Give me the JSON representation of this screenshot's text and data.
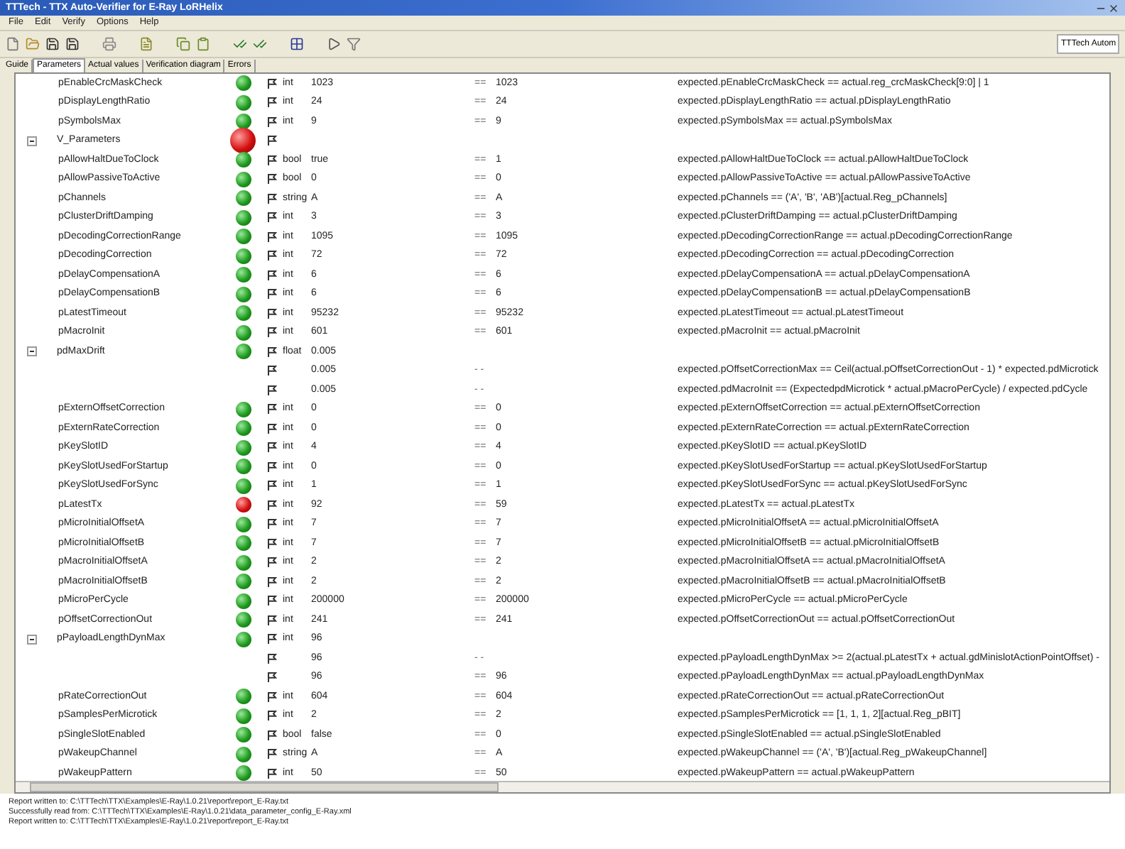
{
  "window": {
    "title": "TTTech - TTX Auto-Verifier for E-Ray LoRHelix"
  },
  "menu": [
    "File",
    "Edit",
    "Verify",
    "Options",
    "Help"
  ],
  "toolbar_combo": {
    "value": "TTTech Autom"
  },
  "tabs": [
    {
      "label": "Guide",
      "selected": false
    },
    {
      "label": "Parameters",
      "selected": true
    },
    {
      "label": "Actual values",
      "selected": false
    },
    {
      "label": "Verification diagram",
      "selected": false
    },
    {
      "label": "Errors",
      "selected": false
    }
  ],
  "rows": [
    {
      "name": "pEnableCrcMaskCheck",
      "passed": true,
      "type": "int",
      "value": "1023",
      "op": "==",
      "actual": "1023",
      "expression": "expected.pEnableCrcMaskCheck == actual.reg_crcMaskCheck[9:0] | 1"
    },
    {
      "name": "pDisplayLengthRatio",
      "passed": true,
      "type": "int",
      "value": "24",
      "op": "==",
      "actual": "24",
      "expression": "expected.pDisplayLengthRatio == actual.pDisplayLengthRatio"
    },
    {
      "name": "pSymbolsMax",
      "passed": true,
      "type": "int",
      "value": "9",
      "op": "==",
      "actual": "9",
      "expression": "expected.pSymbolsMax == actual.pSymbolsMax"
    },
    {
      "name": "V_Parameters",
      "passed": false,
      "expanded": true,
      "children": [
        {
          "name": "pAllowHaltDueToClock",
          "passed": true,
          "type": "bool",
          "value": "true",
          "op": "==",
          "actual": "1",
          "expression": "expected.pAllowHaltDueToClock == actual.pAllowHaltDueToClock"
        },
        {
          "name": "pAllowPassiveToActive",
          "passed": true,
          "type": "bool",
          "value": "0",
          "op": "==",
          "actual": "0",
          "expression": "expected.pAllowPassiveToActive == actual.pAllowPassiveToActive"
        },
        {
          "name": "pChannels",
          "passed": true,
          "type": "string",
          "value": "A",
          "op": "==",
          "actual": "A",
          "expression": "expected.pChannels == ('A', 'B', 'AB')[actual.Reg_pChannels]"
        },
        {
          "name": "pClusterDriftDamping",
          "passed": true,
          "type": "int",
          "value": "3",
          "op": "==",
          "actual": "3",
          "expression": "expected.pClusterDriftDamping == actual.pClusterDriftDamping"
        },
        {
          "name": "pDecodingCorrectionRange",
          "passed": true,
          "type": "int",
          "value": "1095",
          "op": "==",
          "actual": "1095",
          "expression": "expected.pDecodingCorrectionRange == actual.pDecodingCorrectionRange"
        },
        {
          "name": "pDecodingCorrection",
          "passed": true,
          "type": "int",
          "value": "72",
          "op": "==",
          "actual": "72",
          "expression": "expected.pDecodingCorrection == actual.pDecodingCorrection"
        },
        {
          "name": "pDelayCompensationA",
          "passed": true,
          "type": "int",
          "value": "6",
          "op": "==",
          "actual": "6",
          "expression": "expected.pDelayCompensationA == actual.pDelayCompensationA"
        },
        {
          "name": "pDelayCompensationB",
          "passed": true,
          "type": "int",
          "value": "6",
          "op": "==",
          "actual": "6",
          "expression": "expected.pDelayCompensationB == actual.pDelayCompensationB"
        },
        {
          "name": "pLatestTimeout",
          "passed": true,
          "type": "int",
          "value": "95232",
          "op": "==",
          "actual": "95232",
          "expression": "expected.pLatestTimeout == actual.pLatestTimeout"
        },
        {
          "name": "pMacroInit",
          "passed": true,
          "type": "int",
          "value": "601",
          "op": "==",
          "actual": "601",
          "expression": "expected.pMacroInit == actual.pMacroInit"
        },
        {
          "name": "pdMaxDrift",
          "passed": true,
          "type": "float",
          "value": "0.005",
          "expanded": true,
          "children": [
            {
              "value": "0.005",
              "op": "- -",
              "expression": "expected.pOffsetCorrectionMax == Ceil(actual.pOffsetCorrectionOut - 1) * expected.pdMicrotick"
            },
            {
              "value": "0.005",
              "op": "- -",
              "expression": "expected.pdMacroInit == (ExpectedpdMicrotick * actual.pMacroPerCycle) / expected.pdCycle"
            }
          ]
        },
        {
          "name": "pExternOffsetCorrection",
          "passed": true,
          "type": "int",
          "value": "0",
          "op": "==",
          "actual": "0",
          "expression": "expected.pExternOffsetCorrection == actual.pExternOffsetCorrection"
        },
        {
          "name": "pExternRateCorrection",
          "passed": true,
          "type": "int",
          "value": "0",
          "op": "==",
          "actual": "0",
          "expression": "expected.pExternRateCorrection == actual.pExternRateCorrection"
        },
        {
          "name": "pKeySlotID",
          "passed": true,
          "type": "int",
          "value": "4",
          "op": "==",
          "actual": "4",
          "expression": "expected.pKeySlotID == actual.pKeySlotID"
        },
        {
          "name": "pKeySlotUsedForStartup",
          "passed": true,
          "type": "int",
          "value": "0",
          "op": "==",
          "actual": "0",
          "expression": "expected.pKeySlotUsedForStartup == actual.pKeySlotUsedForStartup"
        },
        {
          "name": "pKeySlotUsedForSync",
          "passed": true,
          "type": "int",
          "value": "1",
          "op": "==",
          "actual": "1",
          "expression": "expected.pKeySlotUsedForSync == actual.pKeySlotUsedForSync"
        },
        {
          "name": "pLatestTx",
          "passed": false,
          "type": "int",
          "value": "92",
          "op": "==",
          "actual": "59",
          "expression": "expected.pLatestTx == actual.pLatestTx"
        },
        {
          "name": "pMicroInitialOffsetA",
          "passed": true,
          "type": "int",
          "value": "7",
          "op": "==",
          "actual": "7",
          "expression": "expected.pMicroInitialOffsetA == actual.pMicroInitialOffsetA"
        },
        {
          "name": "pMicroInitialOffsetB",
          "passed": true,
          "type": "int",
          "value": "7",
          "op": "==",
          "actual": "7",
          "expression": "expected.pMicroInitialOffsetB == actual.pMicroInitialOffsetB"
        },
        {
          "name": "pMacroInitialOffsetA",
          "passed": true,
          "type": "int",
          "value": "2",
          "op": "==",
          "actual": "2",
          "expression": "expected.pMacroInitialOffsetA == actual.pMacroInitialOffsetA"
        },
        {
          "name": "pMacroInitialOffsetB",
          "passed": true,
          "type": "int",
          "value": "2",
          "op": "==",
          "actual": "2",
          "expression": "expected.pMacroInitialOffsetB == actual.pMacroInitialOffsetB"
        },
        {
          "name": "pMicroPerCycle",
          "passed": true,
          "type": "int",
          "value": "200000",
          "op": "==",
          "actual": "200000",
          "expression": "expected.pMicroPerCycle == actual.pMicroPerCycle"
        },
        {
          "name": "pOffsetCorrectionOut",
          "passed": true,
          "type": "int",
          "value": "241",
          "op": "==",
          "actual": "241",
          "expression": "expected.pOffsetCorrectionOut == actual.pOffsetCorrectionOut"
        },
        {
          "name": "pPayloadLengthDynMax",
          "passed": true,
          "type": "int",
          "value": "96",
          "expanded": true,
          "children": [
            {
              "value": "96",
              "op": "- -",
              "expression": "expected.pPayloadLengthDynMax >= 2(actual.pLatestTx + actual.gdMinislotActionPointOffset) -"
            },
            {
              "value": "96",
              "op": "==",
              "actual": "96",
              "expression": "expected.pPayloadLengthDynMax == actual.pPayloadLengthDynMax"
            }
          ]
        },
        {
          "name": "pRateCorrectionOut",
          "passed": true,
          "type": "int",
          "value": "604",
          "op": "==",
          "actual": "604",
          "expression": "expected.pRateCorrectionOut == actual.pRateCorrectionOut"
        },
        {
          "name": "pSamplesPerMicrotick",
          "passed": true,
          "type": "int",
          "value": "2",
          "op": "==",
          "actual": "2",
          "expression": "expected.pSamplesPerMicrotick == [1, 1, 1, 2][actual.Reg_pBIT]"
        },
        {
          "name": "pSingleSlotEnabled",
          "passed": true,
          "type": "bool",
          "value": "false",
          "op": "==",
          "actual": "0",
          "expression": "expected.pSingleSlotEnabled == actual.pSingleSlotEnabled"
        },
        {
          "name": "pWakeupChannel",
          "passed": true,
          "type": "string",
          "value": "A",
          "op": "==",
          "actual": "A",
          "expression": "expected.pWakeupChannel == ('A', 'B')[actual.Reg_pWakeupChannel]"
        },
        {
          "name": "pWakeupPattern",
          "passed": true,
          "type": "int",
          "value": "50",
          "op": "==",
          "actual": "50",
          "expression": "expected.pWakeupPattern == actual.pWakeupPattern"
        }
      ]
    }
  ],
  "log": [
    "Report written to: C:\\TTTech\\TTX\\Examples\\E-Ray\\1.0.21\\report\\report_E-Ray.txt",
    "Successfully read from: C:\\TTTech\\TTX\\Examples\\E-Ray\\1.0.21\\data_parameter_config_E-Ray.xml",
    "Report written to: C:\\TTTech\\TTX\\Examples\\E-Ray\\1.0.21\\report\\report_E-Ray.txt"
  ]
}
